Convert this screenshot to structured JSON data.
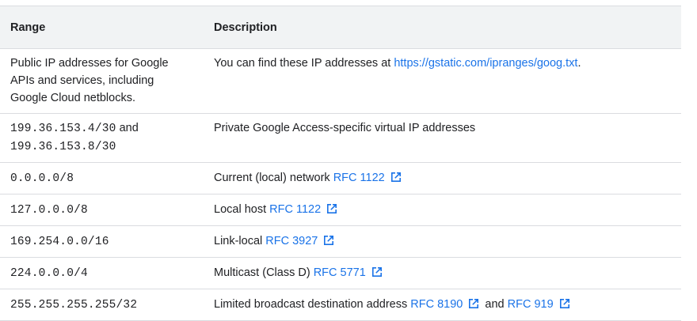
{
  "table": {
    "headers": {
      "range": "Range",
      "description": "Description"
    },
    "rows": [
      {
        "range": "Public IP addresses for Google APIs and services, including Google Cloud netblocks.",
        "desc_text": "You can find these IP addresses at ",
        "desc_link": "https://gstatic.com/ipranges/goog.txt",
        "desc_suffix": "."
      },
      {
        "range_a": "199.36.153.4/30",
        "range_join": "and",
        "range_b": "199.36.153.8/30",
        "desc_text": "Private Google Access-specific virtual IP addresses"
      },
      {
        "range": "0.0.0.0/8",
        "desc_text": "Current (local) network",
        "link1": "RFC 1122"
      },
      {
        "range": "127.0.0.0/8",
        "desc_text": "Local host",
        "link1": "RFC 1122"
      },
      {
        "range": "169.254.0.0/16",
        "desc_text": "Link-local",
        "link1": "RFC 3927"
      },
      {
        "range": "224.0.0.0/4",
        "desc_text": "Multicast (Class D)",
        "link1": "RFC 5771"
      },
      {
        "range": "255.255.255.255/32",
        "desc_text": "Limited broadcast destination address",
        "link1": "RFC 8190",
        "join": "and",
        "link2": "RFC 919"
      }
    ]
  },
  "icons": {
    "external": "external-link-icon"
  },
  "colors": {
    "link": "#1a73e8",
    "header_bg": "#f1f3f4",
    "border": "#dadce0",
    "text": "#202124"
  }
}
